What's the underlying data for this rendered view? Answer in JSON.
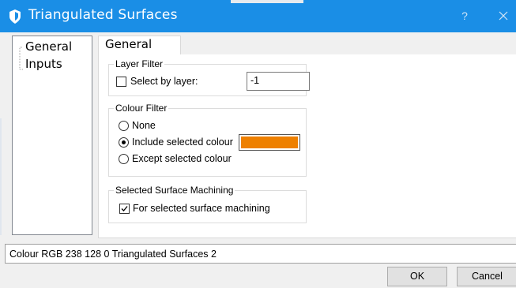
{
  "window": {
    "title": "Triangulated Surfaces",
    "help_label": "?",
    "close_icon": "close-icon",
    "logo_icon": "app-logo-icon",
    "title_bar_color": "#1a8ee6"
  },
  "tree": {
    "items": [
      {
        "label": "General"
      },
      {
        "label": "Inputs"
      }
    ]
  },
  "tab": {
    "label": "General"
  },
  "layer_filter": {
    "legend": "Layer Filter",
    "checkbox_label": "Select by layer:",
    "checked": false,
    "layer_value": "-1"
  },
  "colour_filter": {
    "legend": "Colour Filter",
    "options": [
      {
        "label": "None",
        "selected": false
      },
      {
        "label": "Include selected colour",
        "selected": true
      },
      {
        "label": "Except selected colour",
        "selected": false
      }
    ],
    "swatch_color": "#ee8000"
  },
  "machining": {
    "legend": "Selected Surface Machining",
    "checkbox_label": "For selected surface machining",
    "checked": true
  },
  "status_bar": {
    "text": "Colour RGB 238 128 0 Triangulated Surfaces 2"
  },
  "buttons": {
    "ok": "OK",
    "cancel": "Cancel"
  }
}
